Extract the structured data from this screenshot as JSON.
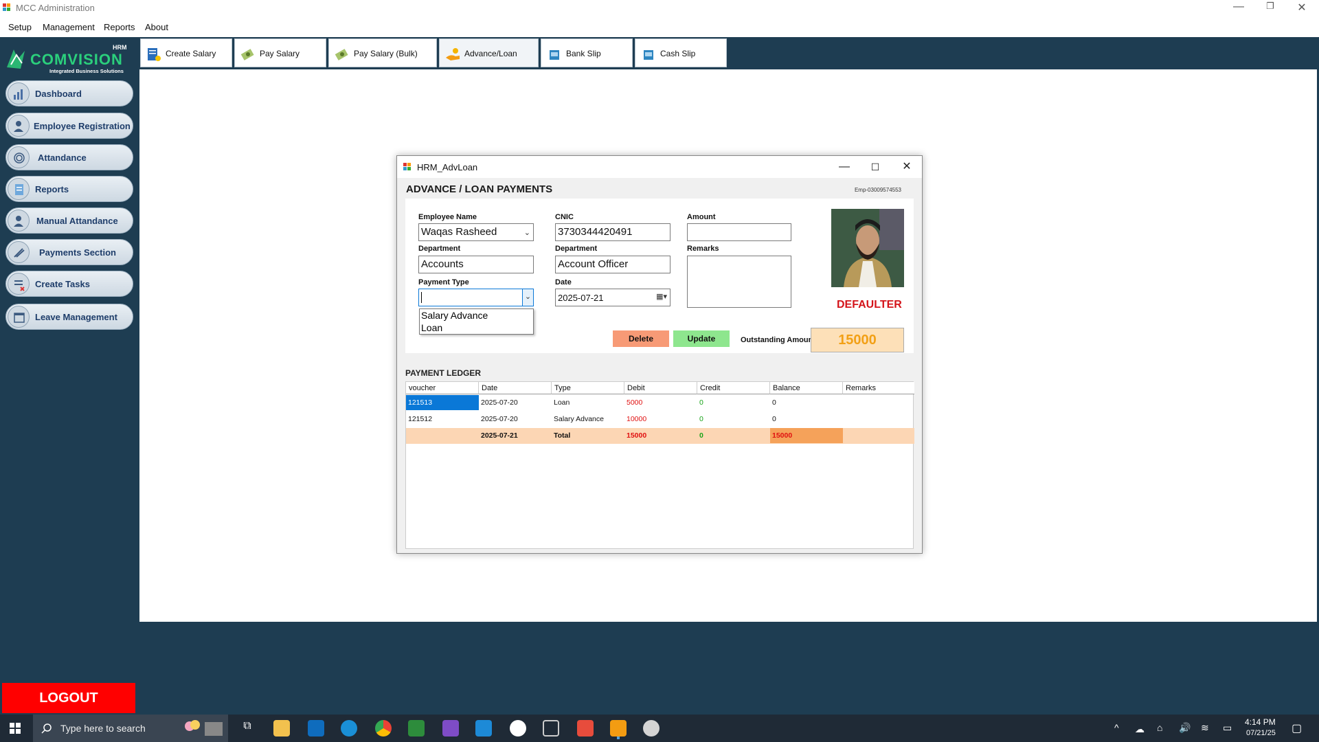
{
  "window": {
    "title": "MCC Administration"
  },
  "menu": [
    "Setup",
    "Management",
    "Reports",
    "About"
  ],
  "logo": {
    "brand": "COMVISION",
    "tag": "Integrated Business Solutions",
    "badge": "HRM"
  },
  "sidebar": {
    "items": [
      {
        "label": "Dashboard",
        "icon": "chart-icon"
      },
      {
        "label": "Employee Registration",
        "icon": "user-add-icon"
      },
      {
        "label": "Attandance",
        "icon": "fingerprint-icon"
      },
      {
        "label": "Reports",
        "icon": "report-icon"
      },
      {
        "label": "Manual Attandance",
        "icon": "user-edit-icon"
      },
      {
        "label": "Payments Section",
        "icon": "payment-icon"
      },
      {
        "label": "Create Tasks",
        "icon": "tasks-icon"
      },
      {
        "label": "Leave Management",
        "icon": "calendar-icon"
      }
    ],
    "logout": "LOGOUT"
  },
  "toolbar": [
    {
      "label": "Create Salary",
      "icon": "salary-sheet-icon"
    },
    {
      "label": "Pay Salary",
      "icon": "money-icon"
    },
    {
      "label": "Pay Salary (Bulk)",
      "icon": "money-icon"
    },
    {
      "label": "Advance/Loan",
      "icon": "hand-coin-icon"
    },
    {
      "label": "Bank Slip",
      "icon": "slip-icon"
    },
    {
      "label": "Cash Slip",
      "icon": "slip-icon"
    }
  ],
  "dialog": {
    "title": "HRM_AdvLoan",
    "heading": "ADVANCE / LOAN PAYMENTS",
    "emp_code": "Emp-03009574553",
    "fields": {
      "employee_name": {
        "label": "Employee Name",
        "value": "Waqas Rasheed"
      },
      "cnic": {
        "label": "CNIC",
        "value": "3730344420491"
      },
      "amount": {
        "label": "Amount",
        "value": ""
      },
      "department": {
        "label": "Department",
        "value": "Accounts"
      },
      "designation": {
        "label": "Department",
        "value": "Account Officer"
      },
      "remarks": {
        "label": "Remarks",
        "value": ""
      },
      "payment_type": {
        "label": "Payment Type",
        "value": "",
        "options": [
          "Salary Advance",
          "Loan"
        ]
      },
      "date": {
        "label": "Date",
        "value": "2025-07-21"
      }
    },
    "status": "DEFAULTER",
    "buttons": {
      "delete": "Delete",
      "update": "Update"
    },
    "outstanding": {
      "label": "Outstanding Amount",
      "value": "15000"
    },
    "ledger": {
      "title": "PAYMENT LEDGER",
      "columns": [
        "voucher",
        "Date",
        "Type",
        "Debit",
        "Credit",
        "Balance",
        "Remarks"
      ],
      "rows": [
        [
          "121513",
          "2025-07-20",
          "Loan",
          "5000",
          "0",
          "0",
          ""
        ],
        [
          "121512",
          "2025-07-20",
          "Salary Advance",
          "10000",
          "0",
          "0",
          ""
        ]
      ],
      "total": [
        "",
        "2025-07-21",
        "Total",
        "15000",
        "0",
        "15000",
        ""
      ]
    }
  },
  "taskbar": {
    "search_placeholder": "Type here to search",
    "time": "4:14 PM",
    "date": "07/21/25"
  },
  "colors": {
    "sidebar": "#1e3d52",
    "logout": "#ff0000",
    "delete": "#f79a76",
    "update": "#8ee68e",
    "total_row": "#fcd6b4",
    "selected": "#0a78d7"
  }
}
